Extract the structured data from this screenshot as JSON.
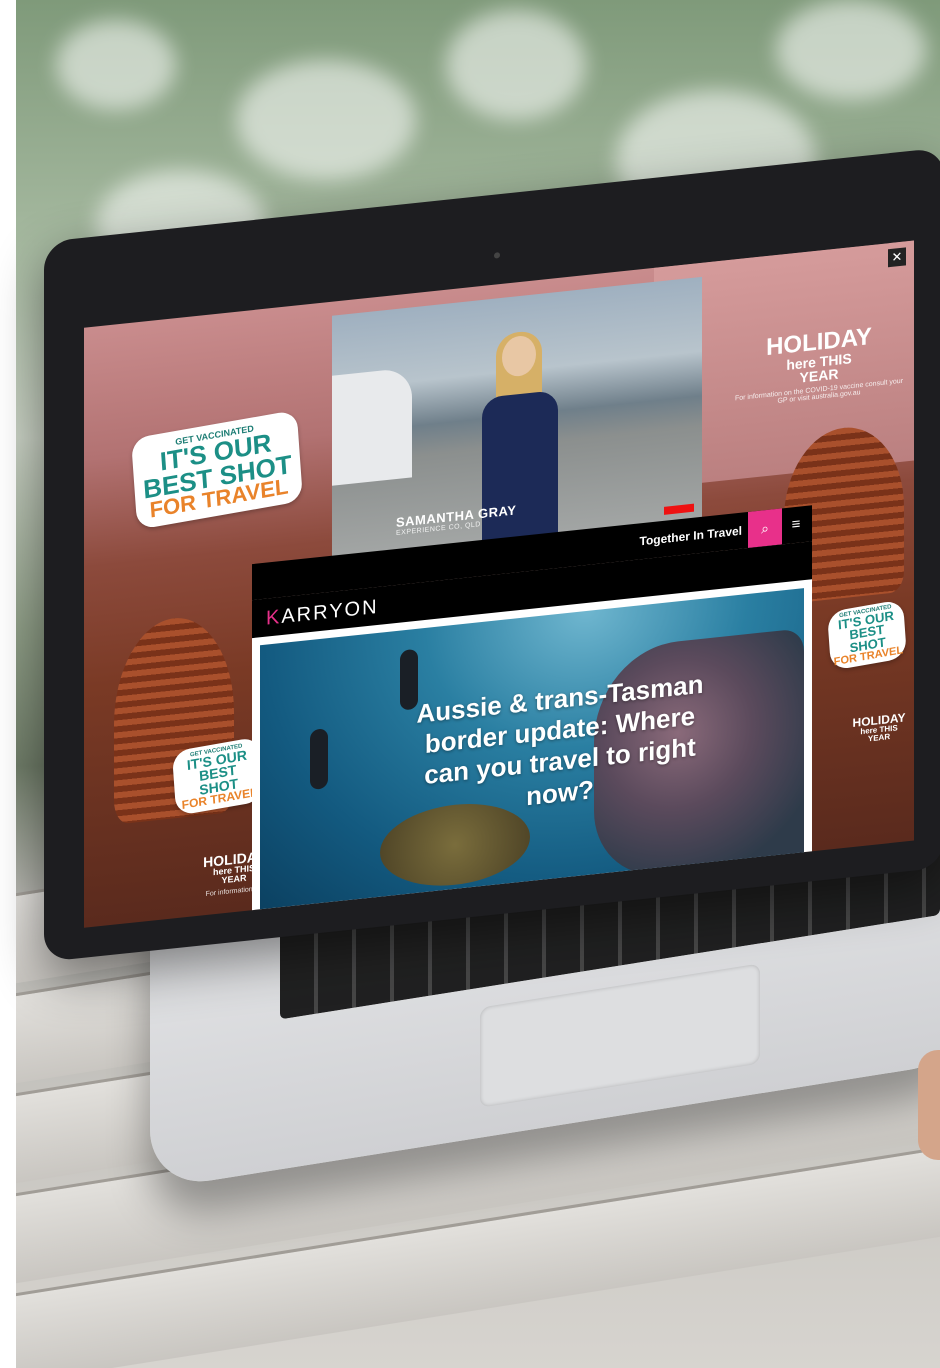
{
  "screen": {
    "close_icon": "close-icon",
    "video": {
      "person_name": "SAMANTHA GRAY",
      "person_role": "EXPERIENCE CO, QLD"
    },
    "sticker_large": {
      "line1": "GET VACCINATED",
      "line2": "IT'S OUR",
      "line3": "BEST SHOT",
      "line4": "FOR TRAVEL"
    },
    "holiday_top": {
      "line1": "HOLIDAY",
      "line2": "here THIS",
      "line3": "YEAR",
      "note": "For information on the COVID-19 vaccine consult your GP or visit australia.gov.au"
    },
    "holiday_small": {
      "line1": "HOLIDAY",
      "line2": "here THIS",
      "line3": "YEAR",
      "note": "For information on"
    }
  },
  "site": {
    "tagline": "Together In Travel",
    "search_icon": "search-icon",
    "menu_icon": "menu-icon",
    "logo_k": "K",
    "logo_rest": "ARRYON",
    "headline": "Aussie & trans-Tasman border update: Where can you travel to right now?"
  }
}
